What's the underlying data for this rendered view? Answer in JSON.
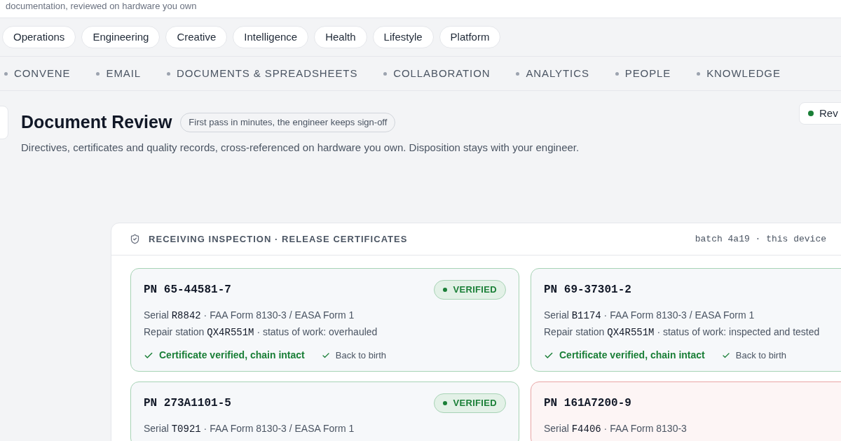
{
  "intro": "documentation, reviewed on hardware you own",
  "categories": [
    {
      "label": "Operations",
      "selected": false
    },
    {
      "label": "Engineering",
      "selected": false
    },
    {
      "label": "Creative",
      "selected": false
    },
    {
      "label": "Intelligence",
      "selected": false
    },
    {
      "label": "Health",
      "selected": false
    },
    {
      "label": "Lifestyle",
      "selected": false
    },
    {
      "label": "Platform",
      "selected": false
    }
  ],
  "sections": [
    "CONVENE",
    "EMAIL",
    "DOCUMENTS & SPREADSHEETS",
    "COLLABORATION",
    "ANALYTICS",
    "PEOPLE",
    "KNOWLEDGE"
  ],
  "header": {
    "title": "Document Review",
    "tag": "First pass in minutes, the engineer keeps sign-off",
    "subtitle": "Directives, certificates and quality records, cross-referenced on hardware you own. Disposition stays with your engineer.",
    "status_pill": "Rev"
  },
  "panel": {
    "title": "RECEIVING INSPECTION · RELEASE CERTIFICATES",
    "meta": "batch 4a19 · this device",
    "cards": [
      {
        "kind": "verified",
        "badge": "VERIFIED",
        "pn_label": "PN",
        "pn": "65-44581-7",
        "serial_label": "Serial",
        "serial": "R8842",
        "form": "· FAA Form 8130-3 / EASA Form 1",
        "station_label": "Repair station",
        "station": "QX4R551M",
        "work": "· status of work: overhauled",
        "checks": [
          {
            "kind": "primary",
            "label": "Certificate verified, chain intact"
          },
          {
            "kind": "secondary",
            "label": "Back to birth"
          }
        ]
      },
      {
        "kind": "verified",
        "pn_label": "PN",
        "pn": "69-37301-2",
        "serial_label": "Serial",
        "serial": "B1174",
        "form": "· FAA Form 8130-3 / EASA Form 1",
        "station_label": "Repair station",
        "station": "QX4R551M",
        "work": "· status of work: inspected and tested",
        "checks": [
          {
            "kind": "primary",
            "label": "Certificate verified, chain intact"
          },
          {
            "kind": "secondary",
            "label": "Back to birth"
          }
        ]
      },
      {
        "kind": "verified",
        "badge": "VERIFIED",
        "pn_label": "PN",
        "pn": "273A1101-5",
        "serial_label": "Serial",
        "serial": "T0921",
        "form": "· FAA Form 8130-3 / EASA Form 1"
      },
      {
        "kind": "flagged",
        "pn_label": "PN",
        "pn": "161A7200-9",
        "serial_label": "Serial",
        "serial": "F4406",
        "form": "· FAA Form 8130-3"
      }
    ]
  }
}
